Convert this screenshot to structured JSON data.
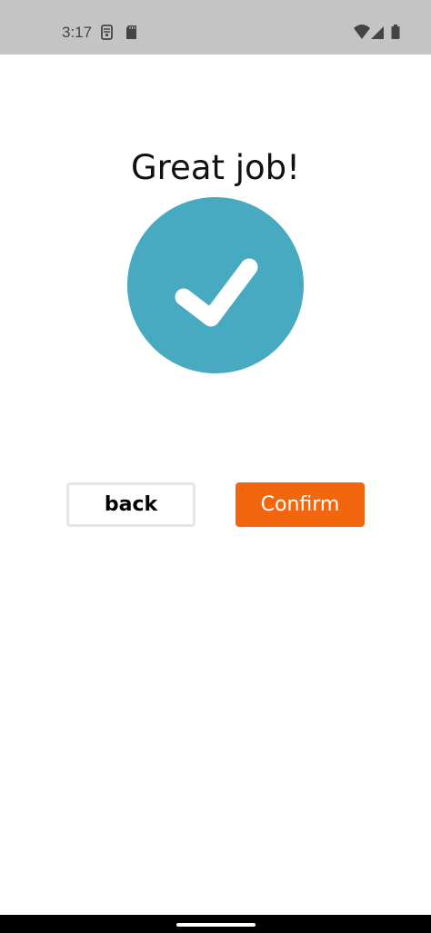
{
  "status_bar": {
    "time": "3:17",
    "icons": [
      "sim-settings-icon",
      "sd-card-icon",
      "wifi-icon",
      "signal-icon",
      "battery-icon"
    ]
  },
  "main": {
    "title": "Great job!",
    "success_icon": "checkmark-icon",
    "success_color": "#47aac0"
  },
  "actions": {
    "back_label": "back",
    "confirm_label": "Confirm",
    "confirm_color": "#f2660e"
  },
  "nav": {
    "home_indicator": "home-indicator"
  }
}
